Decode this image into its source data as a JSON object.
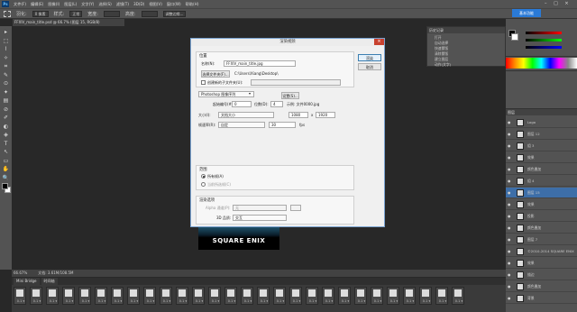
{
  "menubar": {
    "logo": "Ps",
    "items": [
      "文件(F)",
      "编辑(E)",
      "图像(I)",
      "图层(L)",
      "文字(Y)",
      "选择(S)",
      "滤镜(T)",
      "3D(D)",
      "视图(V)",
      "窗口(W)",
      "帮助(H)"
    ]
  },
  "options": {
    "feather_label": "羽化:",
    "feather_value": "0 像素",
    "style_label": "样式:",
    "style_value": "正常",
    "width_label": "宽度:",
    "height_label": "高度:",
    "refine_label": "调整边缘..."
  },
  "essentials": "基本功能",
  "window_controls": "– □ ×",
  "doc_tab": "FFXIV_main_title.psd @ 66.7% (图层 15, RGB/8)",
  "tools": [
    "▸",
    "⬚",
    "⌇",
    "✧",
    "⌗",
    "✎",
    "⊙",
    "✦",
    "▤",
    "⊘",
    "✐",
    "◐",
    "◈",
    "T",
    "↖",
    "▭",
    "✋",
    "🔍"
  ],
  "status": {
    "zoom": "66.67%",
    "doc": "文档: 3.61M/108.5M"
  },
  "timeline": {
    "tabs": [
      "Mini Bridge",
      "时间轴"
    ],
    "frame_time": "0.1 ▾",
    "frame_count": 28
  },
  "history": {
    "title": "历史记录",
    "rows": [
      "打开",
      "自动选择",
      "快速蒙版",
      "清除蒙版",
      "建立图层",
      "动作(文字)"
    ]
  },
  "image_preview": {
    "text": "SQUARE ENIX"
  },
  "layers": {
    "title": "图层",
    "rows": [
      {
        "name": "Logo",
        "sel": false
      },
      {
        "name": "图层 12",
        "sel": false
      },
      {
        "name": "组 3",
        "sel": false
      },
      {
        "name": "效果",
        "sel": false
      },
      {
        "name": "颜色叠加",
        "sel": false
      },
      {
        "name": "组 4",
        "sel": false
      },
      {
        "name": "图层 15",
        "sel": true
      },
      {
        "name": "效果",
        "sel": false
      },
      {
        "name": "投影",
        "sel": false
      },
      {
        "name": "颜色叠加",
        "sel": false
      },
      {
        "name": "图层 7",
        "sel": false
      },
      {
        "name": "©2010-2014 SQUARE ENIX",
        "sel": false
      },
      {
        "name": "效果",
        "sel": false
      },
      {
        "name": "描边",
        "sel": false
      },
      {
        "name": "颜色叠加",
        "sel": false
      },
      {
        "name": "背景",
        "sel": false
      }
    ]
  },
  "dialog": {
    "title": "渲染视频",
    "close": "×",
    "ok": "渲染",
    "cancel": "取消",
    "location_group": "位置",
    "name_label": "名称(N):",
    "name_value": "FFXIV_main_title.jpg",
    "folder_button": "选择文件夹(F)...",
    "folder_path": "C:\\Users\\Xiang\\Desktop\\",
    "subfolder_label": "创建新的子文件夹(U):",
    "format_value": "Photoshop 图像序列",
    "start_label": "起始编号(#):",
    "start_value": "0",
    "digits_label": "位数(D):",
    "digits_value": "4",
    "example_label": "示例: 文件0000.jpg",
    "settings_button": "设置(S)...",
    "size_label": "大小(I):",
    "size_value": "文档大小",
    "width_value": "1080",
    "x": "x",
    "height_value": "1920",
    "fps_label": "帧速率(R):",
    "fps_value": "30",
    "fps_preset": "自定",
    "fps_unit": "fps",
    "range_group": "范围",
    "all_frames": "所有帧(A)",
    "start_frame_label": "开始帧(S):",
    "current_range": "当前所选帧(C)",
    "render_group": "渲染选项",
    "alpha_label": "Alpha 通道(P):",
    "alpha_value": "无",
    "threed_label": "3D 品质:",
    "threed_value": "交互"
  }
}
